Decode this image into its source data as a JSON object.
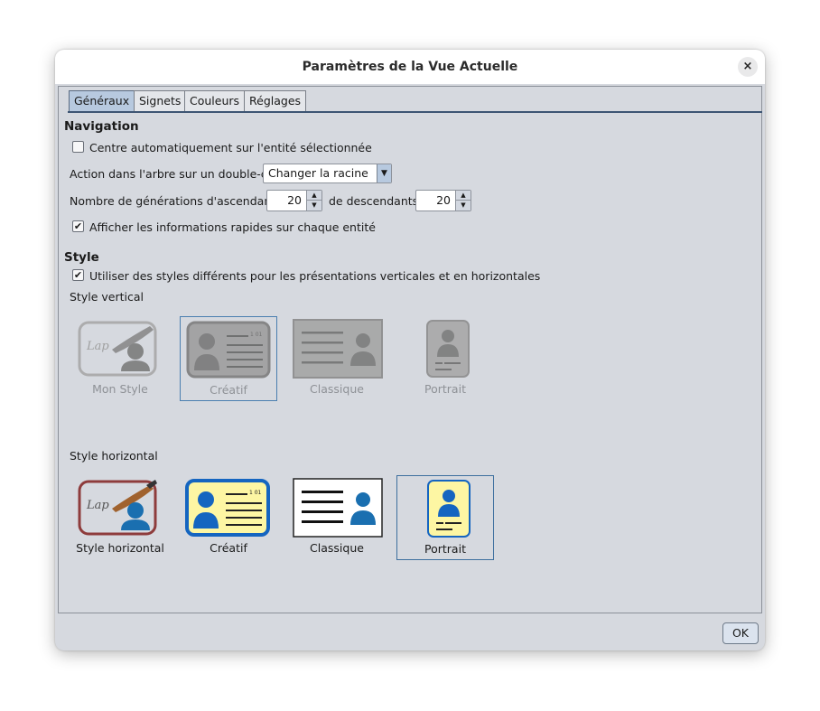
{
  "window": {
    "title": "Paramètres de la Vue Actuelle",
    "close_icon": "×"
  },
  "tabs": [
    {
      "label": "Généraux",
      "active": true
    },
    {
      "label": "Signets",
      "active": false
    },
    {
      "label": "Couleurs",
      "active": false
    },
    {
      "label": "Réglages",
      "active": false
    }
  ],
  "navigation": {
    "heading": "Navigation",
    "auto_center": {
      "label": "Centre automatiquement sur l'entité sélectionnée",
      "checked": false
    },
    "double_click": {
      "label": "Action dans l'arbre sur un double-clic",
      "value": "Changer la racine"
    },
    "generations": {
      "label": "Nombre de générations d'ascendants",
      "ascendants": "20",
      "descendants_label": "de descendants",
      "descendants": "20"
    },
    "quick_info": {
      "label": "Afficher les informations rapides sur chaque entité",
      "checked": true
    }
  },
  "style": {
    "heading": "Style",
    "different_styles": {
      "label": "Utiliser des styles différents pour les présentations verticales et en horizontales",
      "checked": true
    },
    "vertical_label": "Style vertical",
    "vertical_items": [
      {
        "label": "Mon Style",
        "icon": "custom-style-icon",
        "selected": false
      },
      {
        "label": "Créatif",
        "icon": "creative-card-icon",
        "selected": true
      },
      {
        "label": "Classique",
        "icon": "classic-card-icon",
        "selected": false
      },
      {
        "label": "Portrait",
        "icon": "portrait-card-icon",
        "selected": false
      }
    ],
    "horizontal_label": "Style horizontal",
    "horizontal_items": [
      {
        "label": "Style horizontal",
        "icon": "custom-style-icon",
        "selected": false
      },
      {
        "label": "Créatif",
        "icon": "creative-card-icon",
        "selected": false
      },
      {
        "label": "Classique",
        "icon": "classic-card-icon",
        "selected": false
      },
      {
        "label": "Portrait",
        "icon": "portrait-card-icon",
        "selected": true
      }
    ]
  },
  "footer": {
    "ok_label": "OK"
  },
  "colors": {
    "accent_blue": "#1565c0",
    "card_yellow": "#fdf6a3",
    "person_blue": "#1a6fb0",
    "disabled_gray": "#9a9a9a"
  }
}
